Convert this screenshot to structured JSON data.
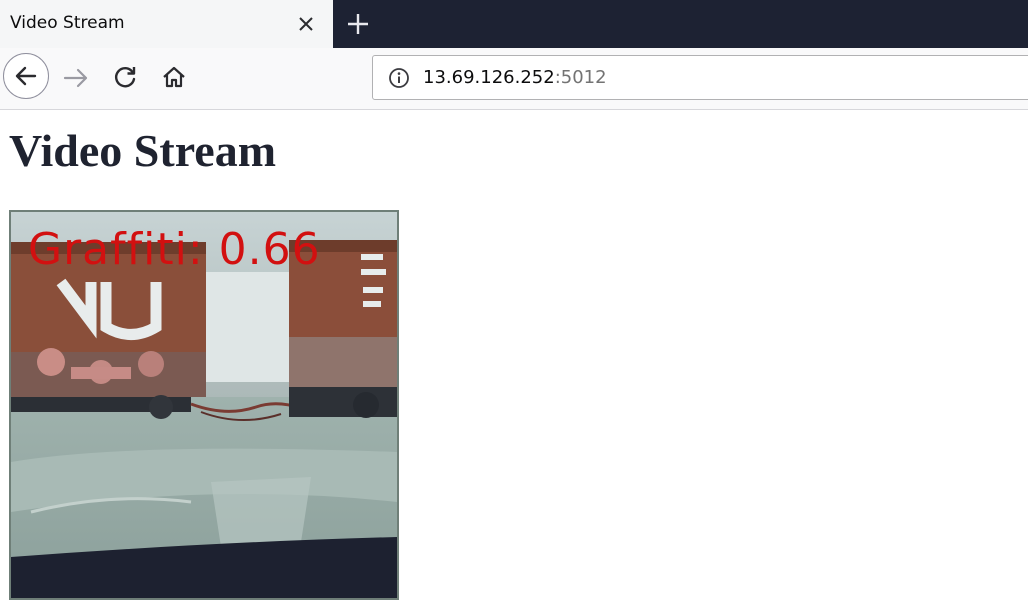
{
  "browser": {
    "tab": {
      "title": "Video Stream"
    },
    "url": {
      "host": "13.69.126.252",
      "port": ":5012"
    }
  },
  "page": {
    "title": "Video Stream",
    "video": {
      "overlay_label": "Graffiti: 0.66"
    }
  }
}
